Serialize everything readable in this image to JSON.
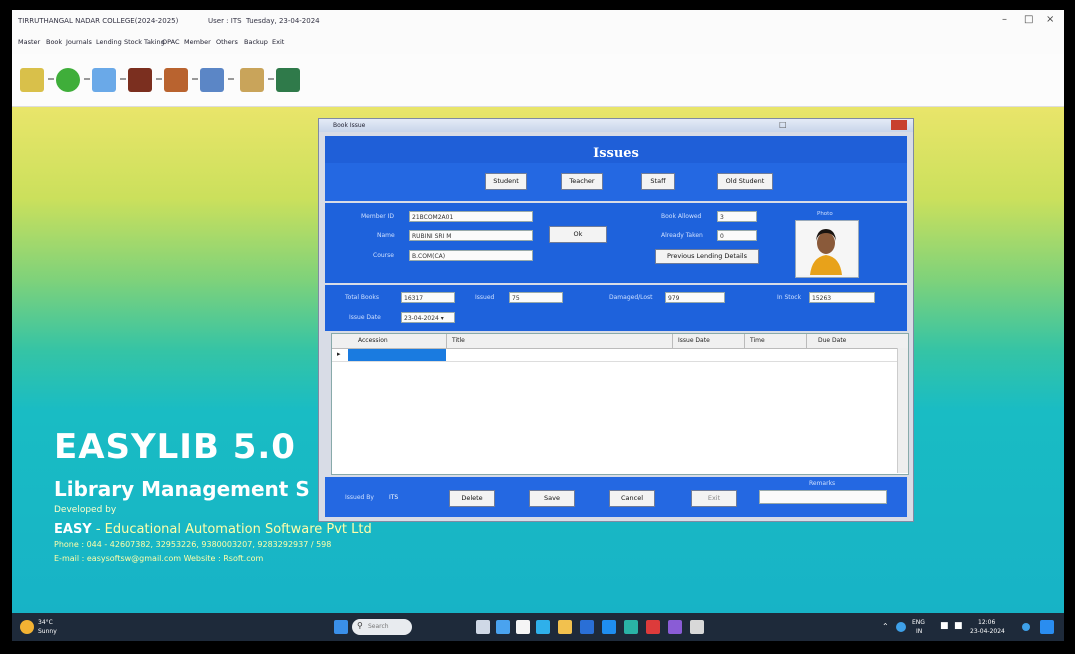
{
  "app": {
    "title": "TIRRUTHANGAL NADAR COLLEGE(2024-2025)",
    "user": "User : ITS",
    "date": "Tuesday, 23-04-2024"
  },
  "menu": [
    "Master",
    "Book",
    "Journals",
    "Lending",
    "Stock Taking",
    "OPAC",
    "Member",
    "Others",
    "Backup",
    "Exit"
  ],
  "toolbar_icons": [
    "key-icon",
    "refresh-icon",
    "notes-icon",
    "bookshelf-icon",
    "person-book-icon",
    "chart-icon",
    "people-icon",
    "exit-door-icon"
  ],
  "brand": {
    "name": "EASYLIB 5.0",
    "subtitle": "Library Management S",
    "developed_by": "Developed by",
    "company_bold": "EASY",
    "company_rest": " - Educational Automation Software Pvt Ltd",
    "phone": "Phone : 044 - 42607382, 32953226, 9380003207, 9283292937 / 598",
    "email": "E-mail : easysoftsw@gmail.com     Website : Rsoft.com"
  },
  "dialog": {
    "window_title": "Book Issue",
    "heading": "Issues",
    "type_buttons": [
      "Student",
      "Teacher",
      "Staff",
      "Old Student"
    ],
    "member": {
      "member_id_label": "Member ID",
      "member_id": "21BCOM2A01",
      "name_label": "Name",
      "name": "RUBINI SRI M",
      "course_label": "Course",
      "course": "B.COM(CA)",
      "ok_label": "Ok",
      "book_allowed_label": "Book Allowed",
      "book_allowed": "3",
      "already_taken_label": "Already Taken",
      "already_taken": "0",
      "prev_lending_label": "Previous Lending Details",
      "photo_label": "Photo"
    },
    "issue": {
      "total_books_label": "Total Books",
      "total_books": "16317",
      "issued_label": "Issued",
      "issued": "75",
      "damaged_label": "Damaged/Lost",
      "damaged": "979",
      "in_stock_label": "In Stock",
      "in_stock": "15263",
      "issue_date_label": "Issue Date",
      "issue_date": "23-04-2024"
    },
    "grid_columns": [
      "Accession",
      "Title",
      "Issue Date",
      "Time",
      "Due Date"
    ],
    "bottom": {
      "issued_by_label": "Issued By",
      "issued_by": "ITS",
      "buttons": [
        "Delete",
        "Save",
        "Cancel",
        "Exit"
      ],
      "remarks_label": "Remarks"
    }
  },
  "taskbar": {
    "weather_temp": "34°C",
    "weather_text": "Sunny",
    "search_placeholder": "Search",
    "lang": "ENG",
    "region": "IN",
    "time": "12:06",
    "date": "23-04-2024"
  }
}
